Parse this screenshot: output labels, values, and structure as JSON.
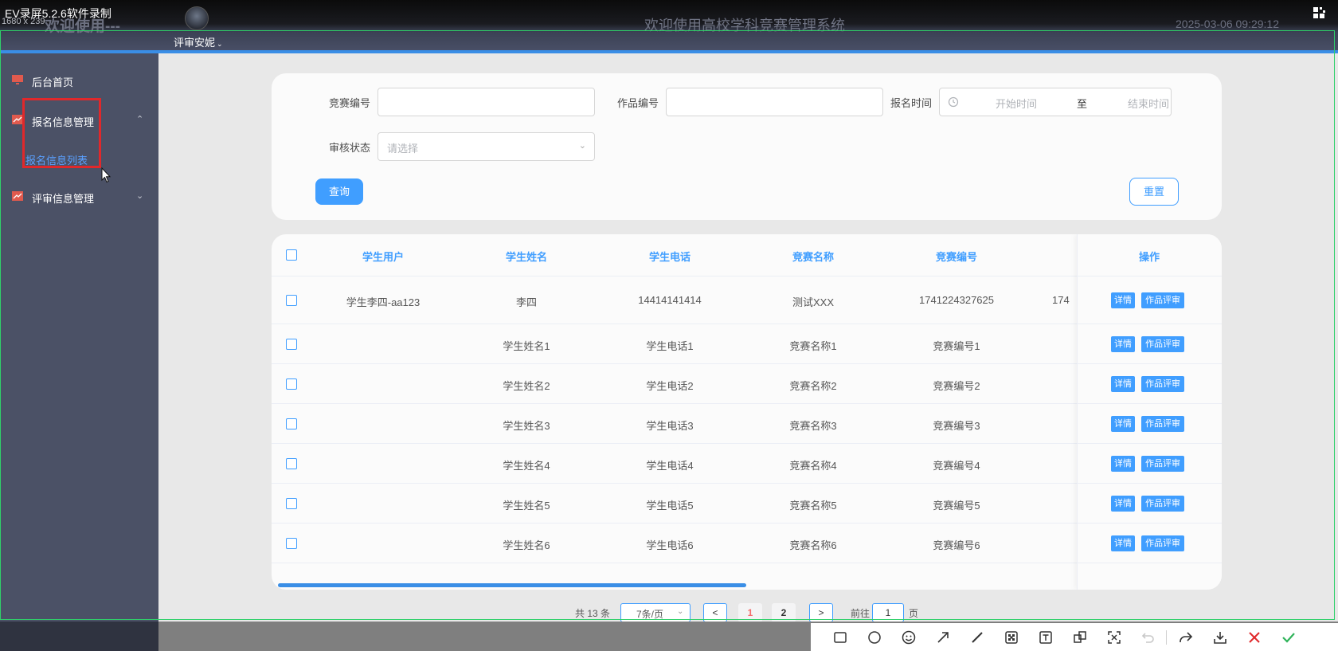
{
  "recorder": {
    "title": "EV录屏5.2.6软件录制",
    "resolution": "1680 x 239"
  },
  "header": {
    "welcome": "欢迎使用---",
    "site_title": "欢迎使用高校学科竞赛管理系统",
    "datetime": "2025-03-06 09:29:12",
    "user_name": "评审安妮"
  },
  "sidebar": {
    "items": [
      {
        "label": "后台首页"
      },
      {
        "label": "报名信息管理",
        "sub": [
          "报名信息列表"
        ]
      },
      {
        "label": "评审信息管理"
      }
    ]
  },
  "filters": {
    "competition_no_label": "竞赛编号",
    "work_no_label": "作品编号",
    "signup_time_label": "报名时间",
    "start_placeholder": "开始时间",
    "range_sep": "至",
    "end_placeholder": "结束时间",
    "review_status_label": "审核状态",
    "review_status_placeholder": "请选择",
    "query_button": "查询",
    "reset_button": "重置"
  },
  "table": {
    "columns": [
      "学生用户",
      "学生姓名",
      "学生电话",
      "竞赛名称",
      "竞赛编号",
      "操作"
    ],
    "rows": [
      {
        "user": "学生李四-aa123",
        "name": "李四",
        "phone": "14414141414",
        "comp_name": "测试XXX",
        "comp_no": "1741224327625",
        "extra": "174"
      },
      {
        "user": "",
        "name": "学生姓名1",
        "phone": "学生电话1",
        "comp_name": "竞赛名称1",
        "comp_no": "竞赛编号1",
        "extra": ""
      },
      {
        "user": "",
        "name": "学生姓名2",
        "phone": "学生电话2",
        "comp_name": "竞赛名称2",
        "comp_no": "竞赛编号2",
        "extra": ""
      },
      {
        "user": "",
        "name": "学生姓名3",
        "phone": "学生电话3",
        "comp_name": "竞赛名称3",
        "comp_no": "竞赛编号3",
        "extra": ""
      },
      {
        "user": "",
        "name": "学生姓名4",
        "phone": "学生电话4",
        "comp_name": "竞赛名称4",
        "comp_no": "竞赛编号4",
        "extra": ""
      },
      {
        "user": "",
        "name": "学生姓名5",
        "phone": "学生电话5",
        "comp_name": "竞赛名称5",
        "comp_no": "竞赛编号5",
        "extra": ""
      },
      {
        "user": "",
        "name": "学生姓名6",
        "phone": "学生电话6",
        "comp_name": "竞赛名称6",
        "comp_no": "竞赛编号6",
        "extra": ""
      }
    ],
    "detail_button": "详情",
    "review_button": "作品评审",
    "scroll_position": 0.5
  },
  "pagination": {
    "total": "共 13 条",
    "page_size": "7条/页",
    "prev": "<",
    "next": ">",
    "pages": [
      "1",
      "2"
    ],
    "current_page": "1",
    "goto_label": "前往",
    "goto_value": "1",
    "page_suffix": "页"
  },
  "colors": {
    "accent": "#409eff",
    "sidebar_bg": "#4b5166",
    "active_page": "#f56c6c",
    "highlight_box": "#e0282b"
  },
  "toolbar_icons": [
    "rectangle-icon",
    "circle-icon",
    "emoji-icon",
    "arrow-icon",
    "line-icon",
    "mosaic-icon",
    "text-icon",
    "copy-icon",
    "ocr-icon",
    "undo-icon",
    "share-icon",
    "download-icon",
    "close-icon",
    "confirm-icon"
  ]
}
